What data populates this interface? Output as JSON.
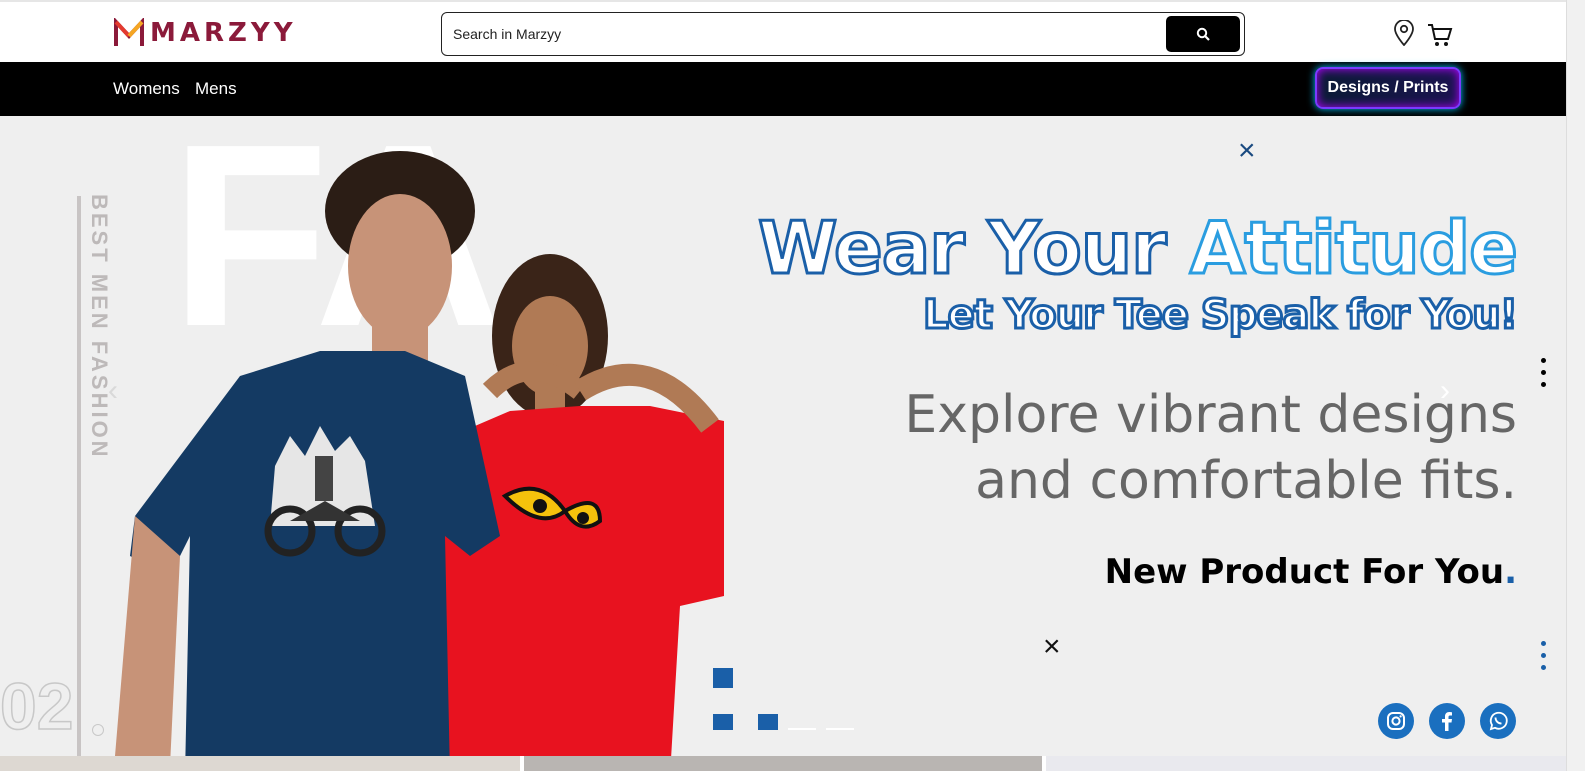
{
  "brand": {
    "name": "MARZYY"
  },
  "search": {
    "placeholder": "Search in Marzyy"
  },
  "nav": {
    "items": [
      "Womens",
      "Mens"
    ],
    "designs_button": "Designs / Prints"
  },
  "hero": {
    "bg_letters": "FA",
    "vertical_text": "BEST MEN FASHION",
    "counter": "02",
    "headline_part1": "Wear Your ",
    "headline_part2": "Attitude",
    "subheadline": "Let Your Tee Speak for You!",
    "description_line1": "Explore vibrant designs",
    "description_line2": "and comfortable fits.",
    "new_product_text": "New Product For You",
    "new_product_dot": "."
  },
  "social": [
    "instagram-icon",
    "facebook-icon",
    "whatsapp-icon"
  ],
  "colors": {
    "accent": "#1a5fa8",
    "logo": "#8b1a3a",
    "navbar": "#000000",
    "tee_navy": "#143a63",
    "tee_red": "#e8121f"
  }
}
